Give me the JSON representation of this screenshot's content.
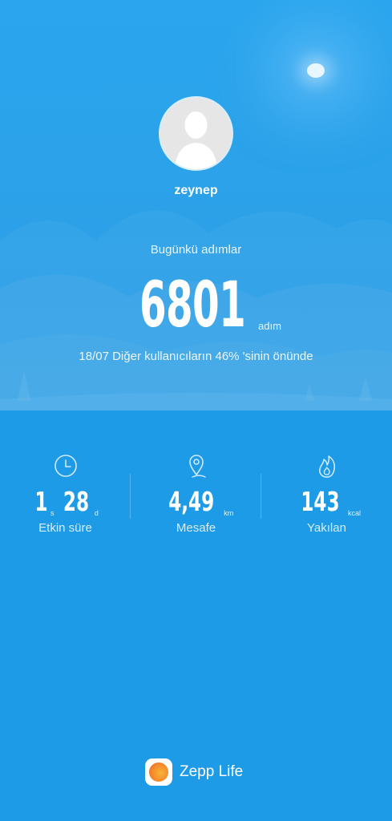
{
  "profile": {
    "name": "zeynep"
  },
  "steps": {
    "label": "Bugünkü adımlar",
    "value": "6801",
    "unit": "adım",
    "rank_text": "18/07 Diğer kullanıcıların 46% 'sinin önünde"
  },
  "stats": {
    "active_time": {
      "hours": "1",
      "hours_unit": "s",
      "minutes": "28",
      "minutes_unit": "d",
      "label": "Etkin süre",
      "icon": "clock-icon"
    },
    "distance": {
      "value": "4,49",
      "unit": "km",
      "label": "Mesafe",
      "icon": "location-pin-icon"
    },
    "burned": {
      "value": "143",
      "unit": "kcal",
      "label": "Yakılan",
      "icon": "flame-icon"
    }
  },
  "brand": {
    "name": "Zepp Life",
    "icon": "zepp-life-logo"
  },
  "colors": {
    "background": "#1e9be6",
    "hero": "#2aa6ee",
    "logo_orange": "#f58a2a"
  }
}
